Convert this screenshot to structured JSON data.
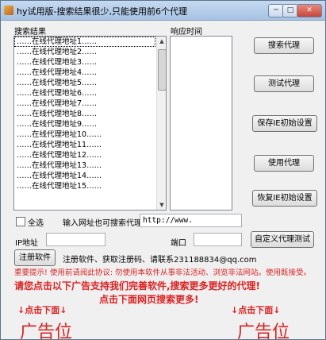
{
  "window": {
    "title": "hy试用版-搜索结果很少,只能使用前6个代理",
    "min_glyph": "─",
    "max_glyph": "□",
    "close_glyph": "✕"
  },
  "labels": {
    "search_results": "搜索结果",
    "response_time": "响应时间",
    "select_all": "全选",
    "url_hint": "输入网址也可搜索代理:",
    "ip": "IP地址",
    "port": "端口"
  },
  "proxy_list": [
    "……在线代理地址1……",
    "……在线代理地址2……",
    "……在线代理地址3……",
    "……在线代理地址4……",
    "……在线代理地址5……",
    "……在线代理地址6……",
    "……在线代理地址7……",
    "……在线代理地址8……",
    "……在线代理地址9……",
    "……在线代理地址10……",
    "……在线代理地址11……",
    "……在线代理地址12……",
    "……在线代理地址13……",
    "……在线代理地址14……",
    "……在线代理地址15……"
  ],
  "buttons": {
    "search_proxy": "搜索代理",
    "test_proxy": "测试代理",
    "save_ie": "保存IE初始设置",
    "use_proxy": "使用代理",
    "restore_ie": "恢复IE初始设置",
    "custom_test": "自定义代理测试",
    "register": "注册软件"
  },
  "inputs": {
    "url_value": "http://www.",
    "ip_value": "",
    "port_value": ""
  },
  "texts": {
    "register_info": "注册软件、获取注册码、请联系231188834@qq.com",
    "notice": "重要提示! 使用前请阅此协议: 勿使用本软件从事非法活动、浏览非法网站。使用既接受。",
    "promo1": "请您点击以下广告支持我们完善软件,搜索更多更好的代理!",
    "promo2": "点击下面网页搜索更多!",
    "ad_left_title": "↓点击下面↓",
    "ad_right_title": "↓点击下面↓",
    "ad_left": "广告位",
    "ad_right": "广告位"
  },
  "colors": {
    "red": "#e02020",
    "titlebar": "#b7cfea"
  }
}
